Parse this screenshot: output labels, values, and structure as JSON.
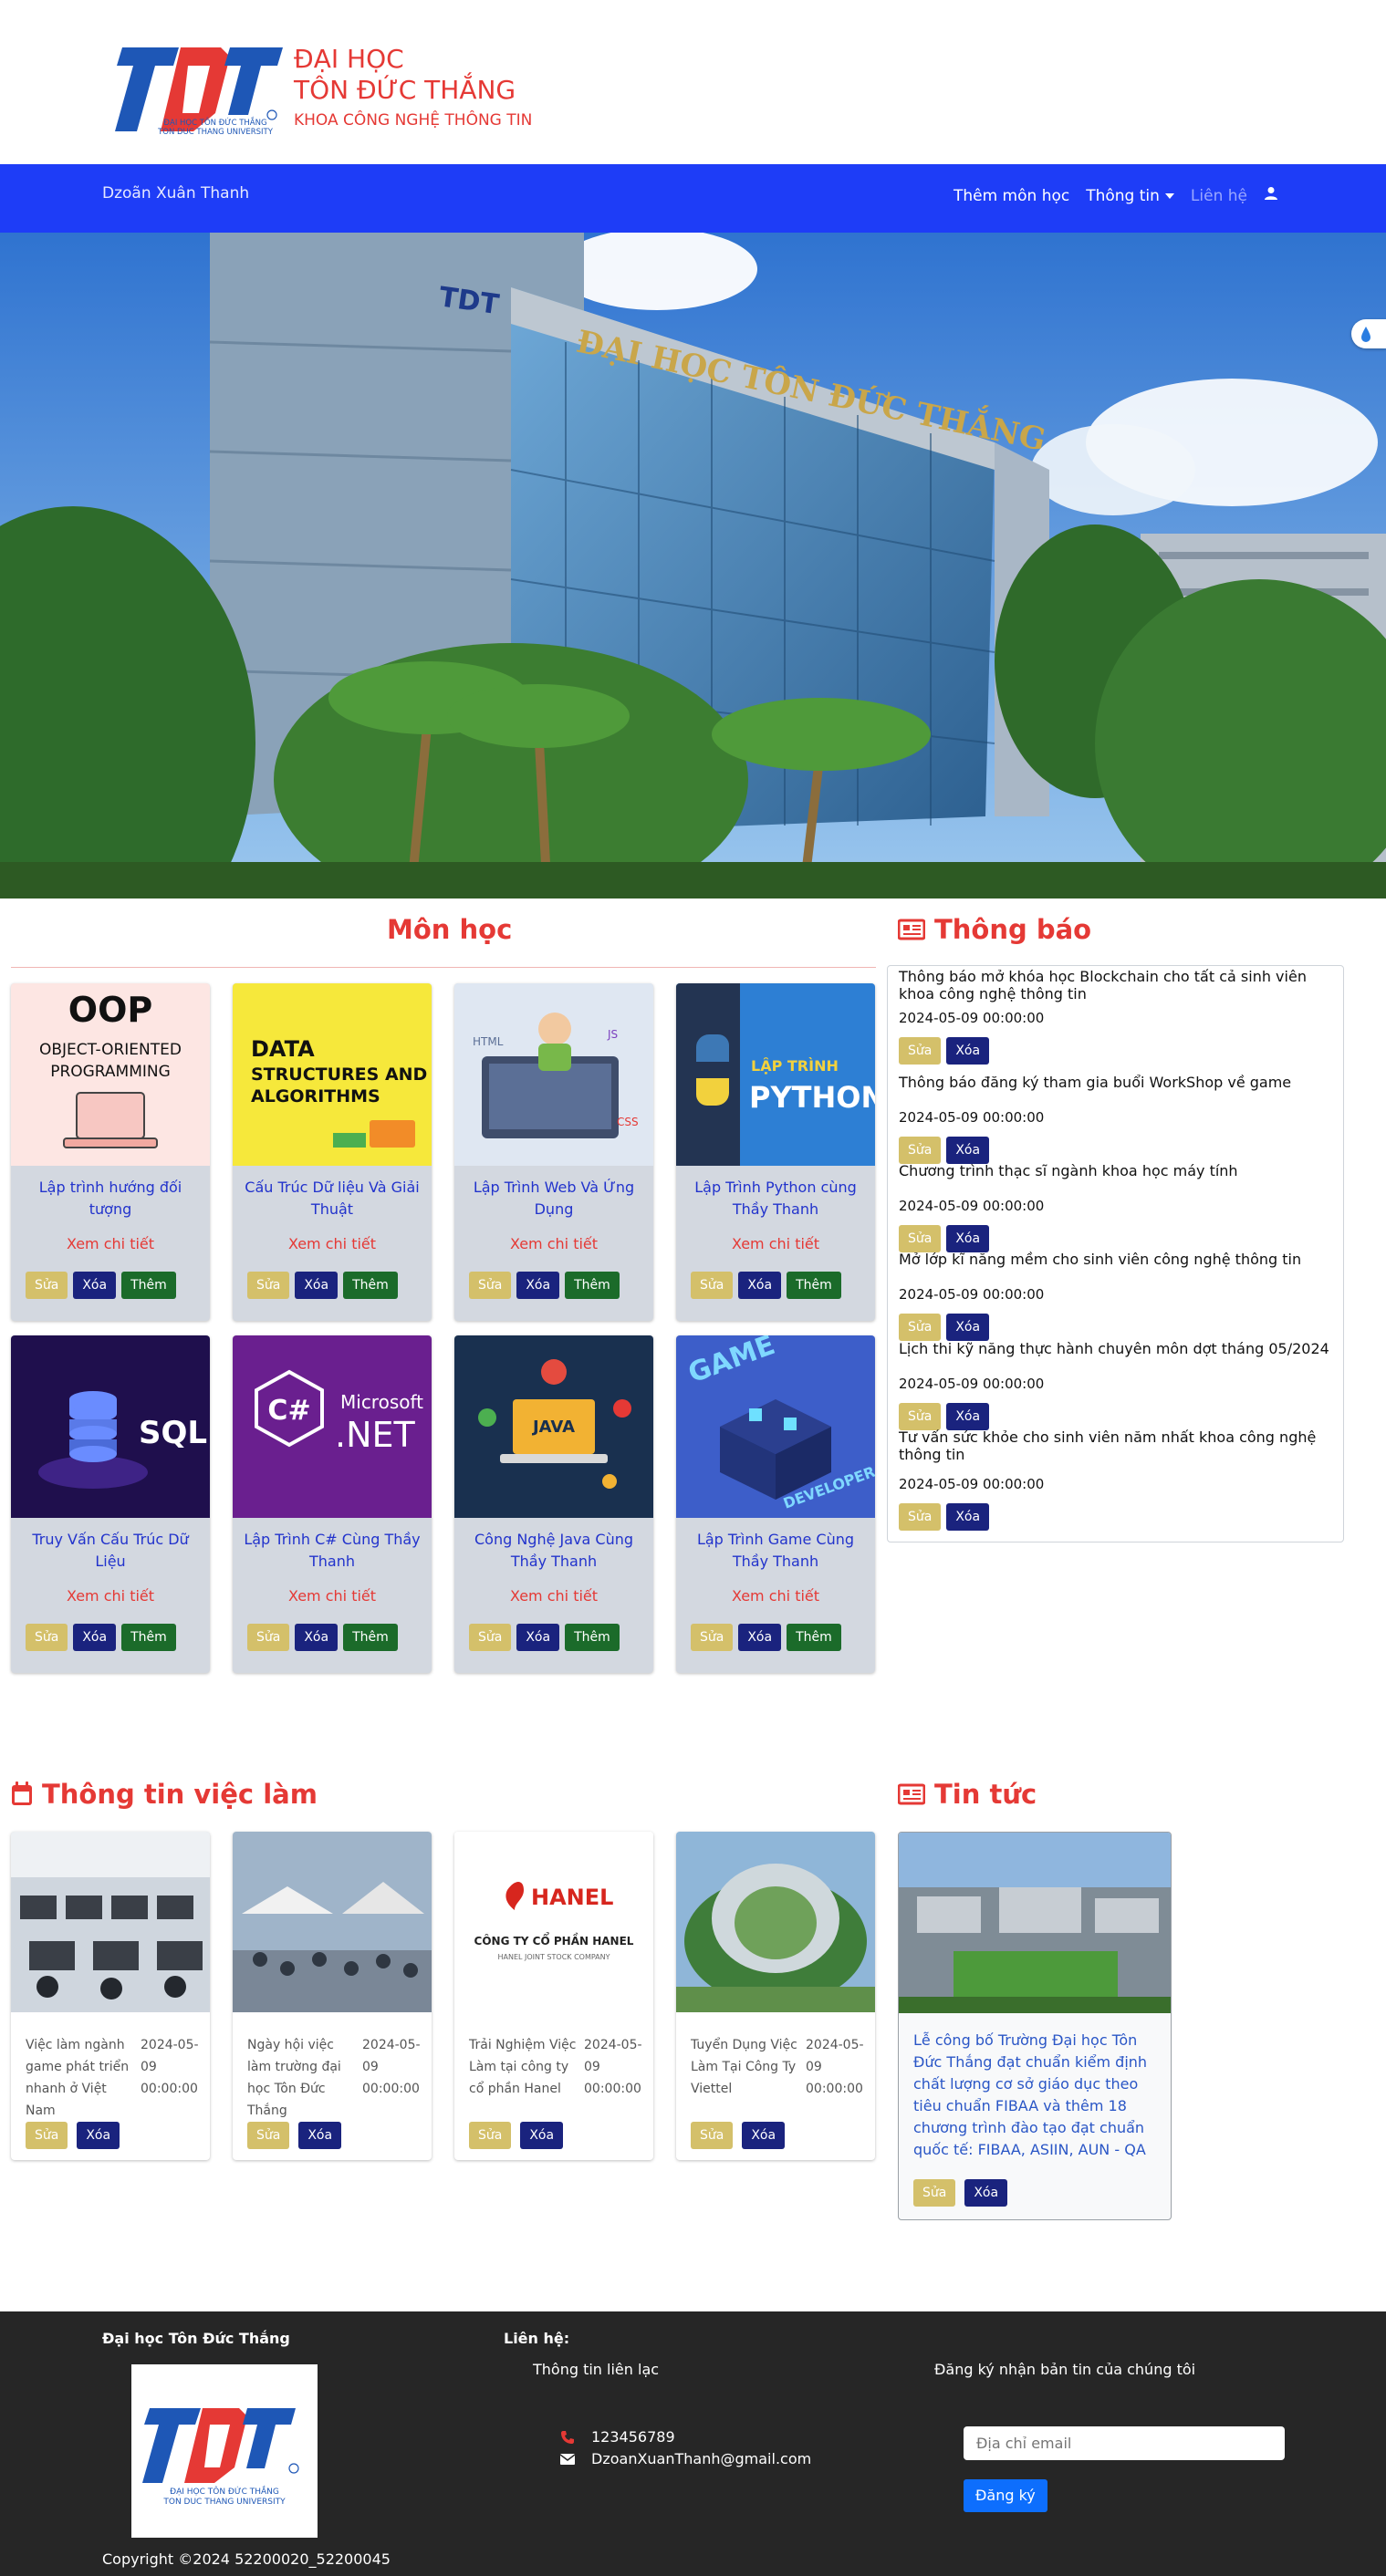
{
  "header": {
    "logo_text_main": "TDT",
    "logo_text_sub1": "ĐẠI HỌC TÔN ĐỨC THẮNG",
    "logo_text_sub2": "TON DUC THANG UNIVERSITY",
    "brand_line1": "ĐẠI HỌC",
    "brand_line2": "TÔN ĐỨC THẮNG",
    "brand_line3": "KHOA CÔNG NGHỆ THÔNG TIN"
  },
  "nav": {
    "brand": "Dzoãn Xuân Thanh",
    "links": [
      {
        "label": "Thêm môn học"
      },
      {
        "label": "Thông tin"
      },
      {
        "label": "Liên hệ"
      }
    ],
    "user_icon": "user-icon"
  },
  "hero": {
    "building_sign": "ĐẠI HỌC TÔN ĐỨC THẮNG",
    "top_logo": "TDT"
  },
  "courses": {
    "title": "Môn học",
    "detail_label": "Xem chi tiết",
    "edit_label": "Sửa",
    "delete_label": "Xóa",
    "add_label": "Thêm",
    "items": [
      {
        "title": "Lập trình hướng đối tượng",
        "img_line1": "OOP",
        "img_line2": "OBJECT-ORIENTED",
        "img_line3": "PROGRAMMING"
      },
      {
        "title": "Cấu Trúc Dữ liệu Và Giải Thuật",
        "img_line1": "DATA",
        "img_line2": "STRUCTURES AND",
        "img_line3": "ALGORITHMS"
      },
      {
        "title": "Lập Trình Web Và Ứng Dụng",
        "img_line1": "HTML",
        "img_line2": "CSS",
        "img_line3": "JS"
      },
      {
        "title": "Lập Trình Python cùng Thầy Thanh",
        "img_line1": "LẬP TRÌNH",
        "img_line2": "PYTHON",
        "img_line3": ""
      },
      {
        "title": "Truy Vấn Cấu Trúc Dữ Liệu",
        "img_line1": "SQL",
        "img_line2": "",
        "img_line3": ""
      },
      {
        "title": "Lập Trình C# Cùng Thầy Thanh",
        "img_line1": "C#",
        "img_line2": "Microsoft",
        "img_line3": ".NET"
      },
      {
        "title": "Công Nghệ Java Cùng Thầy Thanh",
        "img_line1": "JAVA",
        "img_line2": "",
        "img_line3": ""
      },
      {
        "title": "Lập Trình Game Cùng Thầy Thanh",
        "img_line1": "GAME",
        "img_line2": "DEVELOPER",
        "img_line3": ""
      }
    ]
  },
  "notices": {
    "title": "Thông báo",
    "icon": "newspaper-icon",
    "edit_label": "Sửa",
    "delete_label": "Xóa",
    "items": [
      {
        "title": "Thông báo mở khóa học Blockchain cho tất cả sinh viên khoa công nghệ thông tin",
        "date": "2024-05-09 00:00:00"
      },
      {
        "title": "Thông báo đăng ký tham gia buổi WorkShop về game",
        "date": "2024-05-09 00:00:00"
      },
      {
        "title": "Chương trình thạc sĩ ngành khoa học máy tính",
        "date": "2024-05-09 00:00:00"
      },
      {
        "title": "Mở lớp kĩ năng mềm cho sinh viên công nghệ thông tin",
        "date": "2024-05-09 00:00:00"
      },
      {
        "title": "Lịch thi kỹ năng thực hành chuyên môn dợt tháng 05/2024",
        "date": "2024-05-09 00:00:00"
      },
      {
        "title": "Tư vấn sức khỏe cho sinh viên năm nhất khoa công nghệ thông tin",
        "date": "2024-05-09 00:00:00"
      }
    ]
  },
  "jobs": {
    "title": "Thông tin việc làm",
    "icon": "calendar-icon",
    "edit_label": "Sửa",
    "delete_label": "Xóa",
    "items": [
      {
        "title": "Việc làm ngành game phát triển nhanh ở Việt Nam",
        "date": "2024-05-09 00:00:00"
      },
      {
        "title": "Ngày hội việc làm trường đại học Tôn Đức Thắng",
        "date": "2024-05-09 00:00:00"
      },
      {
        "title": "Trải Nghiệm Việc Làm tại công ty cổ phần Hanel",
        "date": "2024-05-09 00:00:00",
        "img_line1": "HANEL",
        "img_line2": "CÔNG TY CỔ PHẦN HANEL",
        "img_line3": "HANEL JOINT STOCK COMPANY"
      },
      {
        "title": "Tuyển Dụng Việc Làm Tại Công Ty Viettel",
        "date": "2024-05-09 00:00:00"
      }
    ]
  },
  "news": {
    "title": "Tin tức",
    "icon": "newspaper-icon",
    "item_title": "Lễ công bố Trường Đại học Tôn Đức Thắng đạt chuẩn kiểm định chất lượng cơ sở giáo dục theo tiêu chuẩn FIBAA và thêm 18 chương trình đào tạo đạt chuẩn quốc tế: FIBAA, ASIIN, AUN - QA",
    "edit_label": "Sửa",
    "delete_label": "Xóa"
  },
  "footer": {
    "school_name": "Đại học Tôn Đức Thắng",
    "contact_head": "Liên hệ:",
    "contact_sub": "Thông tin liên lạc",
    "phone": "123456789",
    "email": "DzoanXuanThanh@gmail.com",
    "newsletter_head": "Đăng ký nhận bản tin của chúng tôi",
    "email_placeholder": "Địa chỉ email",
    "subscribe_label": "Đăng ký",
    "copyright": "Copyright ©2024 52200020_52200045"
  },
  "colors": {
    "accent_red": "#e53935",
    "nav_blue": "#1e3df7",
    "btn_edit": "#d4c06a",
    "btn_delete": "#1a237e",
    "btn_add": "#1b6b2a",
    "footer_bg": "#262626"
  }
}
